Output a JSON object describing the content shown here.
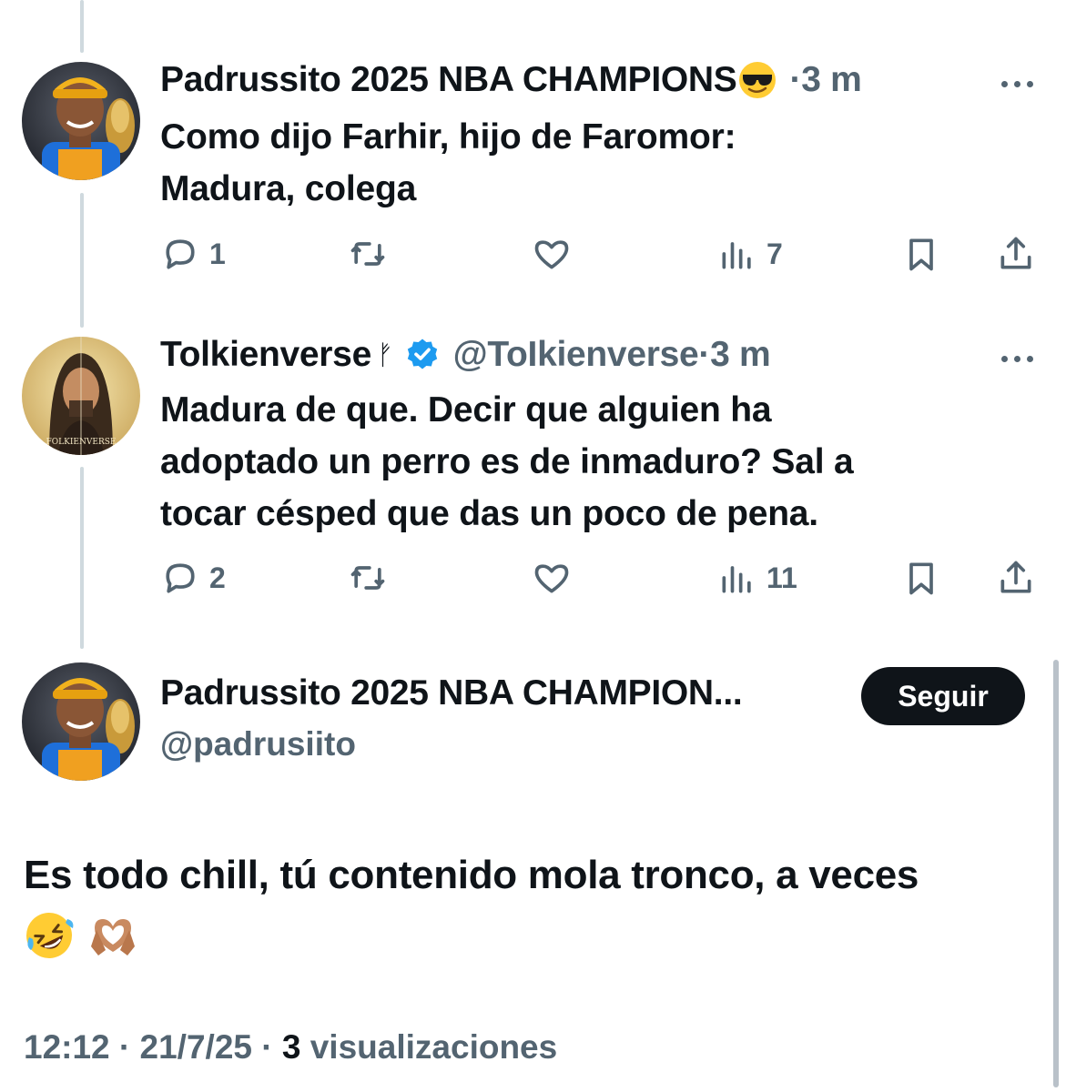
{
  "tweets": [
    {
      "display_name": "Padrussito 2025 NBA CHAMPIONS",
      "name_emoji": "sunglasses-emoji",
      "time": "3 m",
      "text": "Como dijo Farhir, hijo de Faromor:\nMadura, colega",
      "replies": "1",
      "retweets": "",
      "likes": "",
      "views": "7"
    },
    {
      "display_name": "Tolkienverse",
      "name_symbol": "ᚠ",
      "verified": true,
      "handle": "@ToIkienverse",
      "time": "3 m",
      "text": "Madura de que. Decir que alguien ha\nadoptado un perro es de inmaduro? Sal a\ntocar césped que das un poco de pena.",
      "replies": "2",
      "retweets": "",
      "likes": "",
      "views": "11",
      "avatar_caption": "FOLKIENVERSE"
    }
  ],
  "main": {
    "display_name": "Padrussito 2025 NBA CHAMPION...",
    "handle": "@padrusiito",
    "follow_label": "Seguir",
    "text": "Es todo chill, tú contenido mola tronco, a veces",
    "emojis": [
      "rolling-laughing-emoji",
      "heart-hands-emoji"
    ],
    "time": "12:12",
    "date": "21/7/25",
    "views_count": "3",
    "views_label": "visualizaciones"
  },
  "colors": {
    "text": "#0f1419",
    "muted": "#536471",
    "verified": "#1d9bf0",
    "thread_line": "#cfd9de"
  }
}
